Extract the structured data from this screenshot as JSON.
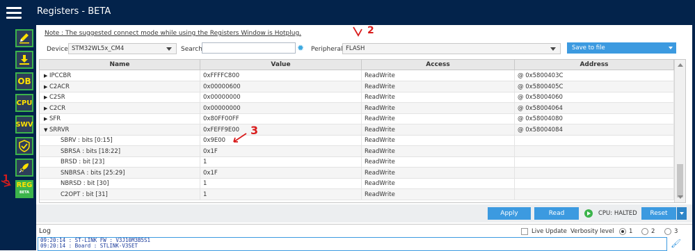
{
  "window": {
    "title": "Registers - BETA"
  },
  "sidebar": {
    "items": [
      {
        "label": "",
        "icon": "pencil-icon"
      },
      {
        "label": "",
        "icon": "download-icon"
      },
      {
        "label": "OB",
        "icon": "option-bytes-icon"
      },
      {
        "label": "CPU",
        "icon": "cpu-icon"
      },
      {
        "label": "SWV",
        "icon": "swv-icon"
      },
      {
        "label": "",
        "icon": "shield-icon"
      },
      {
        "label": "",
        "icon": "rocket-icon"
      },
      {
        "label": "REG",
        "sublabel": "BETA",
        "icon": "registers-icon",
        "active": true
      }
    ]
  },
  "note": "Note : The suggested connect mode while using the Registers Window is Hotplug.",
  "filters": {
    "device_label": "Device :",
    "device_value": "STM32WL5x_CM4",
    "search_label": "Search :",
    "search_value": "",
    "peripheral_label": "Peripheral :",
    "peripheral_value": "FLASH",
    "save_label": "Save to file"
  },
  "table": {
    "columns": [
      "Name",
      "Value",
      "Access",
      "Address"
    ],
    "rows": [
      {
        "name": "IPCCBR",
        "value": "0xFFFFC800",
        "access": "ReadWrite",
        "address": "@ 0x5800403C",
        "expander": "▶"
      },
      {
        "name": "C2ACR",
        "value": "0x00000600",
        "access": "ReadWrite",
        "address": "@ 0x5800405C",
        "expander": "▶"
      },
      {
        "name": "C2SR",
        "value": "0x00000000",
        "access": "ReadWrite",
        "address": "@ 0x58004060",
        "expander": "▶"
      },
      {
        "name": "C2CR",
        "value": "0x00000000",
        "access": "ReadWrite",
        "address": "@ 0x58004064",
        "expander": "▶"
      },
      {
        "name": "SFR",
        "value": "0x80FF00FF",
        "access": "ReadWrite",
        "address": "@ 0x58004080",
        "expander": "▶"
      },
      {
        "name": "SRRVR",
        "value": "0xFEFF9E00",
        "access": "ReadWrite",
        "address": "@ 0x58004084",
        "expander": "▼"
      },
      {
        "name": "SBRV : bits [0:15]",
        "value": "0x9E00",
        "access": "ReadWrite",
        "address": "",
        "expander": ""
      },
      {
        "name": "SBRSA : bits [18:22]",
        "value": "0x1F",
        "access": "ReadWrite",
        "address": "",
        "expander": ""
      },
      {
        "name": "BRSD : bit [23]",
        "value": "1",
        "access": "ReadWrite",
        "address": "",
        "expander": ""
      },
      {
        "name": "SNBRSA : bits [25:29]",
        "value": "0x1F",
        "access": "ReadWrite",
        "address": "",
        "expander": ""
      },
      {
        "name": "NBRSD : bit [30]",
        "value": "1",
        "access": "ReadWrite",
        "address": "",
        "expander": ""
      },
      {
        "name": "C2OPT : bit [31]",
        "value": "1",
        "access": "ReadWrite",
        "address": "",
        "expander": ""
      }
    ]
  },
  "controls": {
    "apply_label": "Apply",
    "read_label": "Read",
    "cpu_status": "CPU: HALTED",
    "reset_label": "Reset"
  },
  "log": {
    "title": "Log",
    "live_update_label": "Live Update",
    "verbosity_label": "Verbosity level",
    "levels": [
      "1",
      "2",
      "3"
    ],
    "selected_level": "1",
    "lines": [
      "09:20:14 : ST-LINK FW  : V3J10M3B5S1",
      "09:20:14 : Board       : STLINK-V3SET"
    ]
  },
  "annotations": {
    "a1": "1",
    "a2": "2",
    "a3": "3"
  },
  "colors": {
    "titlebar": "#03234b",
    "accent": "#3c9ae0",
    "sidebar_border": "#3cb44b",
    "annotation": "#d91c1c"
  }
}
